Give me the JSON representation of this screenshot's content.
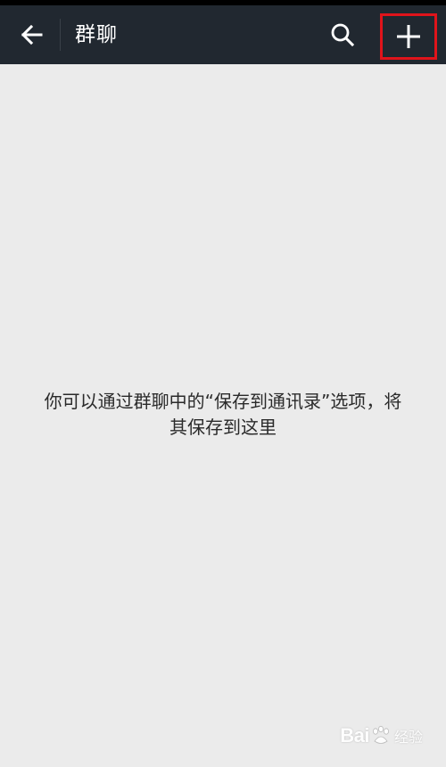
{
  "header": {
    "title": "群聊",
    "back_icon": "arrow-left-icon",
    "search_icon": "search-icon",
    "add_icon": "plus-icon",
    "highlight_color": "#e0141b",
    "bar_color": "#212830"
  },
  "main": {
    "empty_message_line1": "你可以通过群聊中的“保存到通讯录”选项，将",
    "empty_message_line2": "其保存到这里",
    "background_color": "#ebebeb"
  },
  "watermark": {
    "brand_text": "Bai",
    "brand_suffix": "经验"
  }
}
